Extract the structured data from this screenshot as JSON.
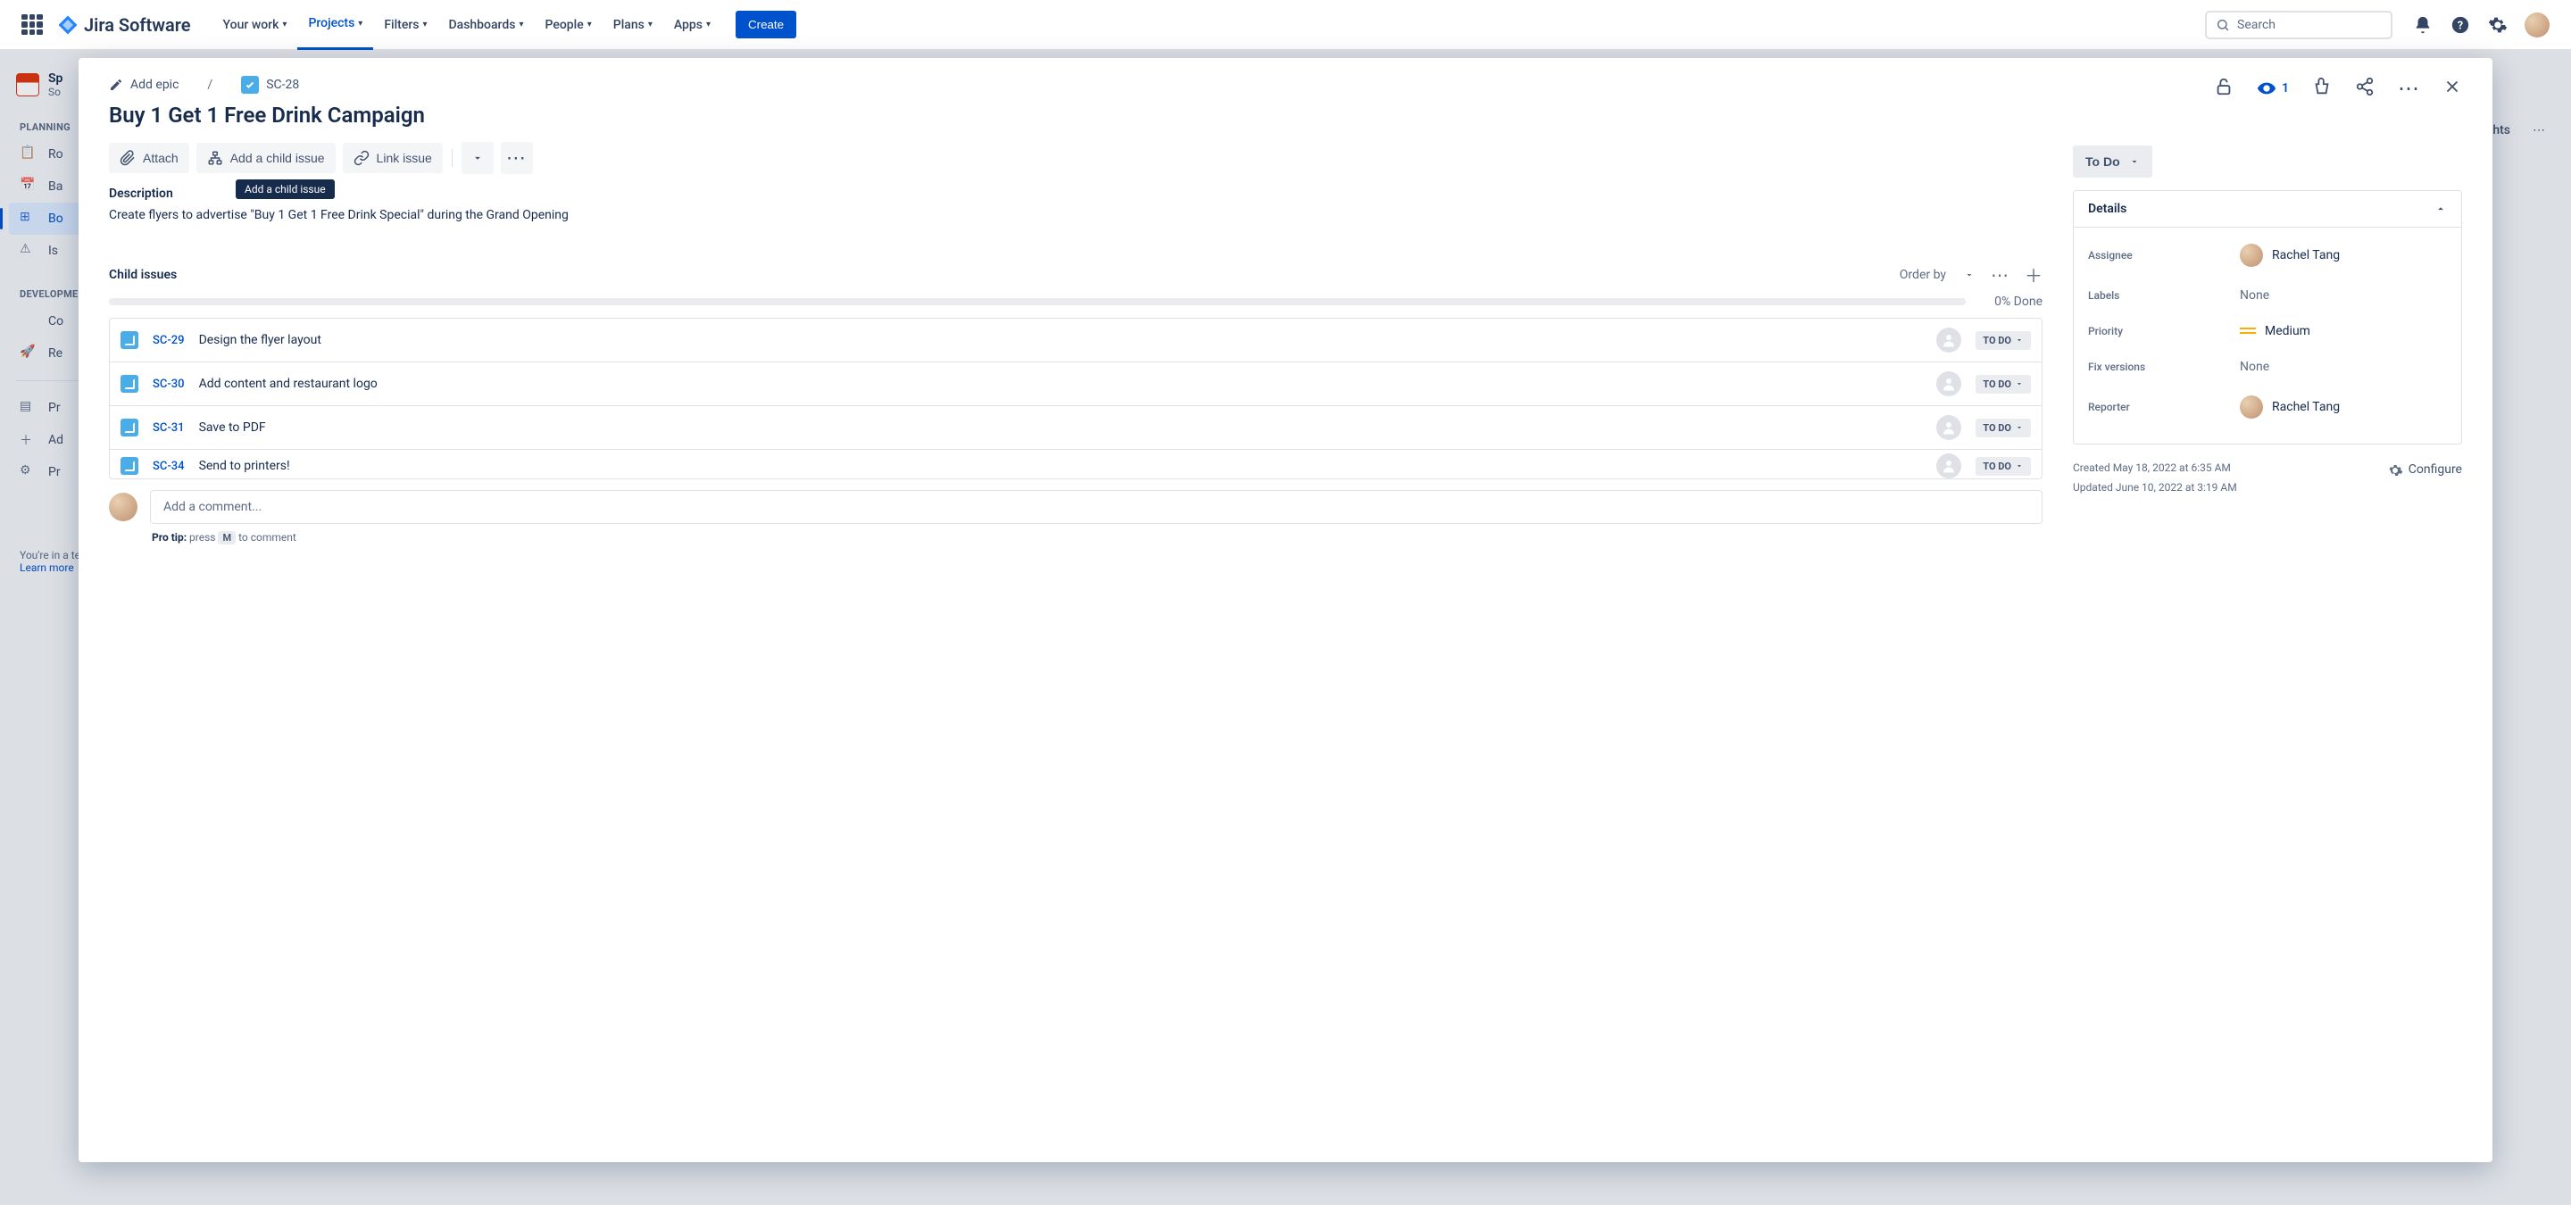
{
  "topnav": {
    "product": "Jira Software",
    "items": [
      "Your work",
      "Projects",
      "Filters",
      "Dashboards",
      "People",
      "Plans",
      "Apps"
    ],
    "active_index": 1,
    "create": "Create",
    "search_placeholder": "Search"
  },
  "sidebar": {
    "project_name": "Sp",
    "project_sub": "So",
    "section_planning": "PLANNING",
    "section_development": "DEVELOPMENT",
    "items_planning": [
      "Ro",
      "Ba",
      "Bo",
      "Is"
    ],
    "items_development": [
      "Co",
      "Re"
    ],
    "items_bottom": [
      "Pr",
      "Ad",
      "Pr"
    ],
    "footer_line": "You're in a team-managed project",
    "learn_more": "Learn more"
  },
  "main_bg": {
    "insights_label": "ghts"
  },
  "modal": {
    "breadcrumb": {
      "add_epic": "Add epic",
      "issue_key": "SC-28"
    },
    "title": "Buy 1 Get 1 Free Drink Campaign",
    "toolbar": {
      "attach": "Attach",
      "add_child": "Add a child issue",
      "link_issue": "Link issue",
      "tooltip": "Add a child issue"
    },
    "top_actions": {
      "watch_count": "1"
    },
    "description_label": "Description",
    "description_text": "Create flyers to advertise \"Buy 1 Get 1 Free Drink Special\" during the Grand Opening",
    "child": {
      "label": "Child issues",
      "order_by": "Order by",
      "done": "0% Done",
      "status_label": "TO DO",
      "rows": [
        {
          "key": "SC-29",
          "summary": "Design the flyer layout"
        },
        {
          "key": "SC-30",
          "summary": "Add content and restaurant logo"
        },
        {
          "key": "SC-31",
          "summary": "Save to PDF"
        },
        {
          "key": "SC-34",
          "summary": "Send to printers!"
        }
      ]
    },
    "comment": {
      "placeholder": "Add a comment...",
      "pro_tip_label": "Pro tip:",
      "pro_tip_press": " press ",
      "pro_tip_key": "M",
      "pro_tip_rest": " to comment"
    },
    "status": "To Do",
    "details": {
      "header": "Details",
      "assignee_label": "Assignee",
      "assignee_value": "Rachel Tang",
      "labels_label": "Labels",
      "labels_value": "None",
      "priority_label": "Priority",
      "priority_value": "Medium",
      "fix_label": "Fix versions",
      "fix_value": "None",
      "reporter_label": "Reporter",
      "reporter_value": "Rachel Tang"
    },
    "timestamps": {
      "created": "Created May 18, 2022 at 6:35 AM",
      "updated": "Updated June 10, 2022 at 3:19 AM",
      "configure": "Configure"
    }
  }
}
